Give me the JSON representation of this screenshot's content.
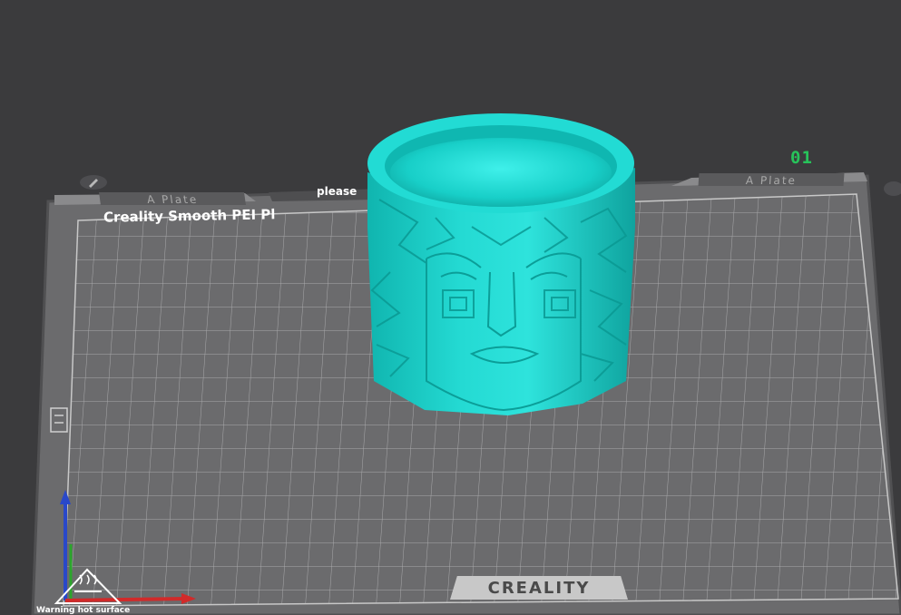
{
  "plate": {
    "left_label": "A Plate",
    "right_label": "A Plate",
    "number": "01",
    "title": "Creality Smooth PEI Pl",
    "note": "please",
    "warning": "Warning hot surface"
  },
  "brand": {
    "logo_text": "CREALITY"
  },
  "colors": {
    "background": "#3b3b3d",
    "bed": "#6c6c6e",
    "grid": "#aaaaaa",
    "model": "#1fd6d0",
    "plate_number": "#27c35a",
    "axis_x": "#d12a2a",
    "axis_y": "#2ca52c",
    "axis_z": "#2948c9"
  },
  "icons": [
    "edit-icon",
    "hot-surface-icon",
    "axis-gizmo-icon"
  ]
}
